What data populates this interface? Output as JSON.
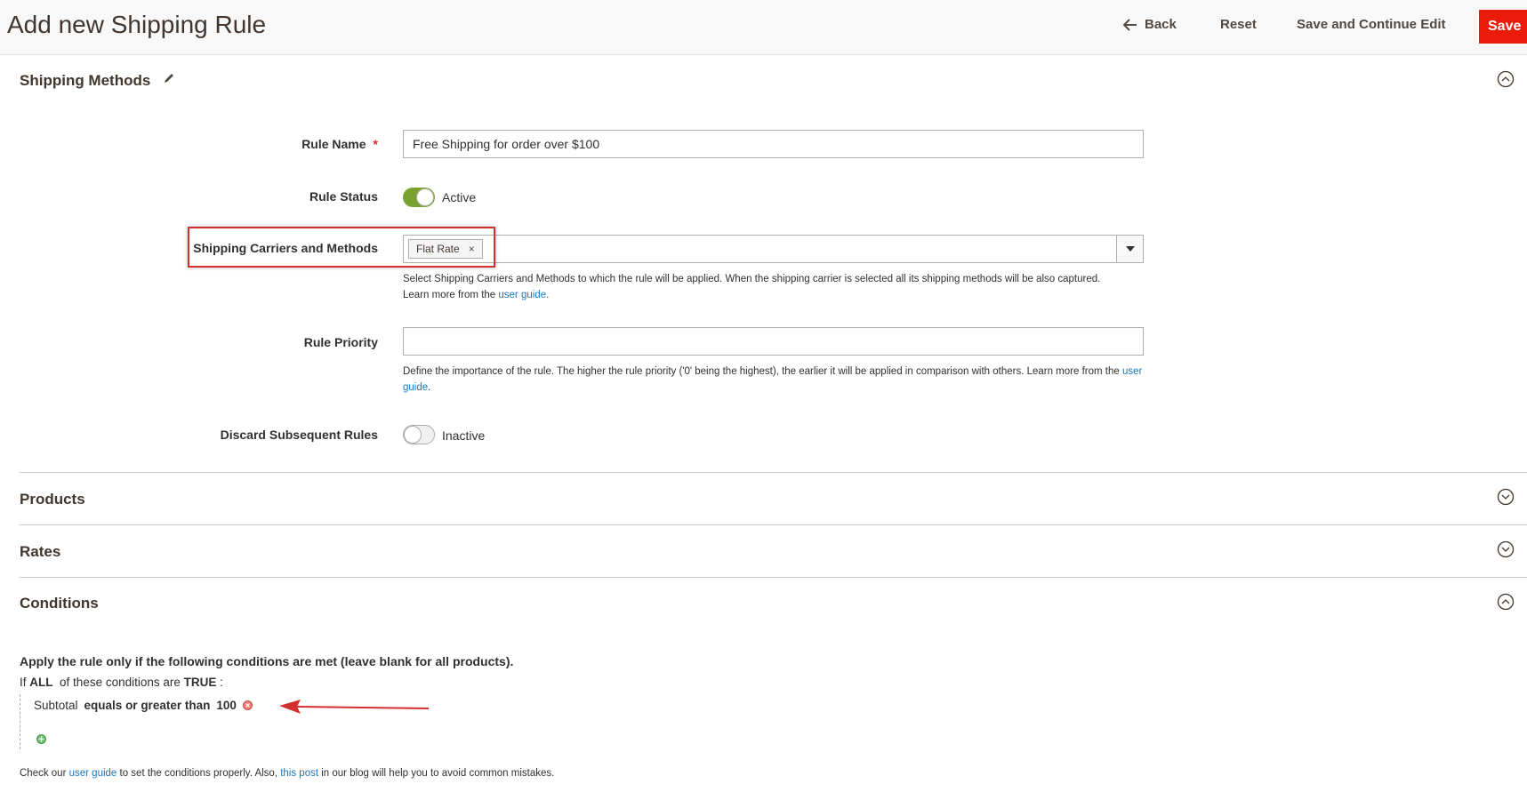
{
  "header": {
    "title": "Add new Shipping Rule",
    "back_label": "Back",
    "reset_label": "Reset",
    "save_continue_label": "Save and Continue Edit",
    "save_label": "Save",
    "save_color": "#eb1b0a"
  },
  "sections": {
    "shipping_methods": "Shipping Methods",
    "products": "Products",
    "rates": "Rates",
    "conditions": "Conditions"
  },
  "form": {
    "rule_name": {
      "label": "Rule Name",
      "required_mark": "*",
      "value": "Free Shipping for order over $100"
    },
    "rule_status": {
      "label": "Rule Status",
      "state_text": "Active",
      "on": true
    },
    "carriers": {
      "label": "Shipping Carriers and Methods",
      "selected_tag": "Flat Rate",
      "tag_remove": "×",
      "note_text": "Select Shipping Carriers and Methods to which the rule will be applied. When the shipping carrier is selected all its shipping methods will be also captured.",
      "note_learn": "Learn more from the ",
      "note_link": "user guide",
      "note_end": "."
    },
    "rule_priority": {
      "label": "Rule Priority",
      "value": "",
      "note_text": "Define the importance of the rule. The higher the rule priority ('0' being the highest), the earlier it will be applied in comparison with others. Learn more from the ",
      "note_link": "user guide",
      "note_end": "."
    },
    "discard": {
      "label": "Discard Subsequent Rules",
      "state_text": "Inactive",
      "on": false
    }
  },
  "conditions": {
    "heading": "Apply the rule only if the following conditions are met (leave blank for all products).",
    "if_text": "If",
    "aggregator": "ALL",
    "middle_text": "of these conditions are",
    "value_word": "TRUE",
    "colon": ":",
    "rule": {
      "attribute": "Subtotal",
      "operator": "equals or greater than",
      "value": "100"
    },
    "footer_1": "Check our ",
    "footer_link1": "user guide",
    "footer_2": " to set the conditions properly. Also, ",
    "footer_link2": "this post",
    "footer_3": " in our blog will help you to avoid common mistakes."
  },
  "icons": {
    "back": "arrow-left-icon",
    "edit": "pencil-icon",
    "collapse": "chevron-circle-icon",
    "dropdown": "caret-down-icon",
    "remove": "remove-condition-icon",
    "add": "add-condition-icon"
  },
  "annotation_color": "#d32f2f"
}
